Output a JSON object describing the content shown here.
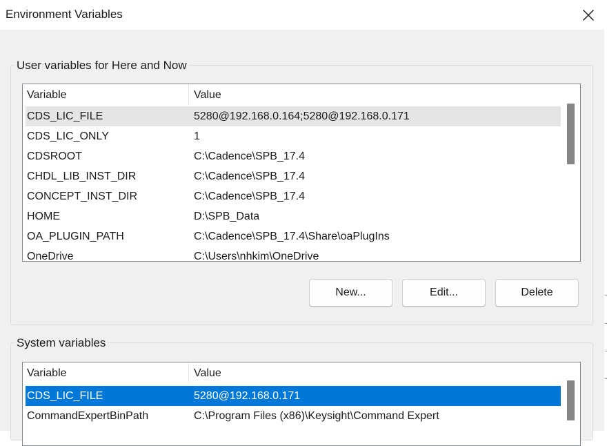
{
  "window": {
    "title": "Environment Variables"
  },
  "user_vars": {
    "group_label": "User variables for Here and Now",
    "columns": {
      "variable": "Variable",
      "value": "Value"
    },
    "rows": [
      {
        "name": "CDS_LIC_FILE",
        "value": "5280@192.168.0.164;5280@192.168.0.171"
      },
      {
        "name": "CDS_LIC_ONLY",
        "value": "1"
      },
      {
        "name": "CDSROOT",
        "value": "C:\\Cadence\\SPB_17.4"
      },
      {
        "name": "CHDL_LIB_INST_DIR",
        "value": "C:\\Cadence\\SPB_17.4"
      },
      {
        "name": "CONCEPT_INST_DIR",
        "value": "C:\\Cadence\\SPB_17.4"
      },
      {
        "name": "HOME",
        "value": "D:\\SPB_Data"
      },
      {
        "name": "OA_PLUGIN_PATH",
        "value": "C:\\Cadence\\SPB_17.4\\Share\\oaPlugIns"
      },
      {
        "name": "OneDrive",
        "value": "C:\\Users\\nhkim\\OneDrive"
      }
    ],
    "buttons": {
      "new": "New...",
      "edit": "Edit...",
      "delete": "Delete"
    }
  },
  "system_vars": {
    "group_label": "System variables",
    "columns": {
      "variable": "Variable",
      "value": "Value"
    },
    "rows": [
      {
        "name": "CDS_LIC_FILE",
        "value": "5280@192.168.0.171"
      },
      {
        "name": "CommandExpertBinPath",
        "value": "C:\\Program Files (x86)\\Keysight\\Command Expert"
      }
    ]
  },
  "icons": {
    "close": "close-icon"
  },
  "colors": {
    "selection": "#0078d7",
    "hover": "#e5e5e5",
    "dialog_bg": "#f0f0f0"
  }
}
